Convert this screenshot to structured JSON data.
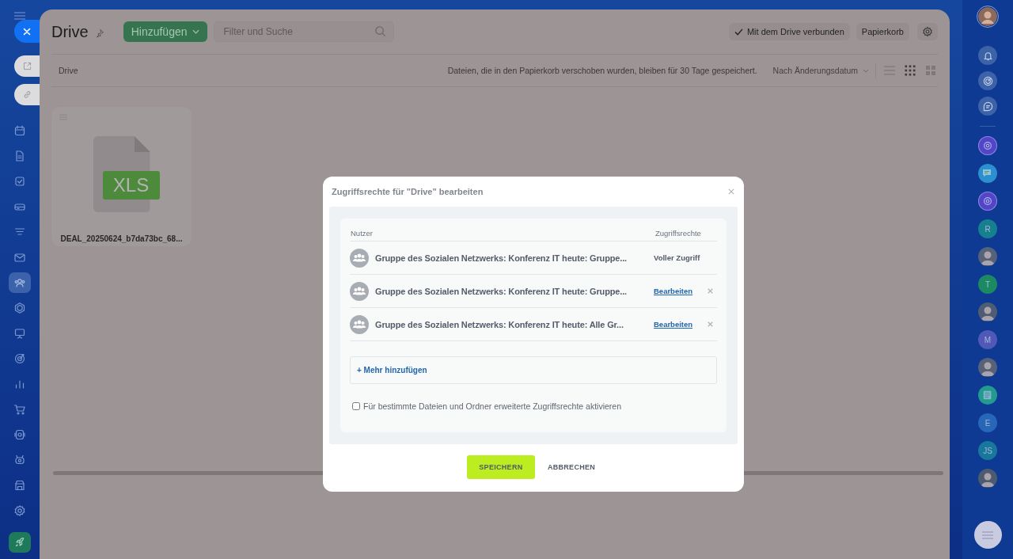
{
  "left_nav": {
    "items": [
      {
        "kind": "calendar",
        "selected": false
      },
      {
        "kind": "document",
        "selected": false
      },
      {
        "kind": "task",
        "selected": false
      },
      {
        "kind": "drive",
        "selected": false
      },
      {
        "kind": "funnel",
        "selected": false
      },
      {
        "kind": "mail",
        "selected": false
      },
      {
        "kind": "people",
        "selected": true
      },
      {
        "kind": "hexagon",
        "selected": false
      },
      {
        "kind": "board",
        "selected": false
      },
      {
        "kind": "target",
        "selected": false
      },
      {
        "kind": "chart",
        "selected": false
      },
      {
        "kind": "cart",
        "selected": false
      },
      {
        "kind": "box",
        "selected": false
      },
      {
        "kind": "robot",
        "selected": false
      },
      {
        "kind": "store",
        "selected": false
      },
      {
        "kind": "settings",
        "selected": false
      },
      {
        "kind": "rocket",
        "selected": false
      }
    ]
  },
  "header": {
    "title": "Drive",
    "add_button": "Hinzufügen",
    "search": {
      "placeholder": "Filter und Suche"
    },
    "sync_status": "Mit dem Drive verbunden",
    "trash_button": "Papierkorb"
  },
  "toolbar": {
    "breadcrumb": "Drive",
    "notice": "Dateien, die in den Papierkorb verschoben wurden, bleiben für 30 Tage gespeichert.",
    "sort": "Nach Änderungsdatum",
    "view_modes": [
      {
        "kind": "list",
        "selected": false
      },
      {
        "kind": "grid",
        "selected": true
      },
      {
        "kind": "tiles",
        "selected": false
      }
    ]
  },
  "files": [
    {
      "name": "DEAL_20250624_b7da73bc_68...",
      "type": "XLS"
    }
  ],
  "right_rail": {
    "tools": [
      {
        "kind": "bell"
      },
      {
        "kind": "radar"
      },
      {
        "kind": "chat"
      }
    ],
    "chats": [
      {
        "kind": "icon",
        "color": "#5146c8"
      },
      {
        "kind": "bubble",
        "color": "#2b8fd0"
      },
      {
        "kind": "icon",
        "color": "#5146c8"
      },
      {
        "kind": "letter",
        "label": "R",
        "color": "#17808f"
      },
      {
        "kind": "photo",
        "color": "#55627a"
      },
      {
        "kind": "letter",
        "label": "T",
        "color": "#1b8a62"
      },
      {
        "kind": "photo",
        "color": "#4f5d73"
      },
      {
        "kind": "letter",
        "label": "M",
        "color": "#5059b8"
      },
      {
        "kind": "photo",
        "color": "#566277"
      },
      {
        "kind": "news",
        "color": "#229a92"
      },
      {
        "kind": "letter",
        "label": "E",
        "color": "#2866b8"
      },
      {
        "kind": "letter",
        "label": "JS",
        "color": "#17789c"
      },
      {
        "kind": "photo",
        "color": "#4e5a70"
      }
    ]
  },
  "dialog": {
    "title": "Zugriffsrechte für \"Drive\" bearbeiten",
    "columns": [
      "Nutzer",
      "Zugriffsrechte"
    ],
    "rows": [
      {
        "name": "Gruppe des Sozialen Netzwerks: Konferenz IT heute: Gruppe...",
        "access": "Voller Zugriff",
        "kind": "fixed"
      },
      {
        "name": "Gruppe des Sozialen Netzwerks: Konferenz IT heute: Gruppe...",
        "access": "Bearbeiten",
        "kind": "editable"
      },
      {
        "name": "Gruppe des Sozialen Netzwerks: Konferenz IT heute: Alle Gr...",
        "access": "Bearbeiten",
        "kind": "editable"
      }
    ],
    "add_more": "+ Mehr hinzufügen",
    "option": {
      "label": "Für bestimmte Dateien und Ordner erweiterte Zugriffsrechte aktivieren",
      "checked": false
    },
    "save_button": "SPEICHERN",
    "cancel_button": "ABBRECHEN"
  }
}
